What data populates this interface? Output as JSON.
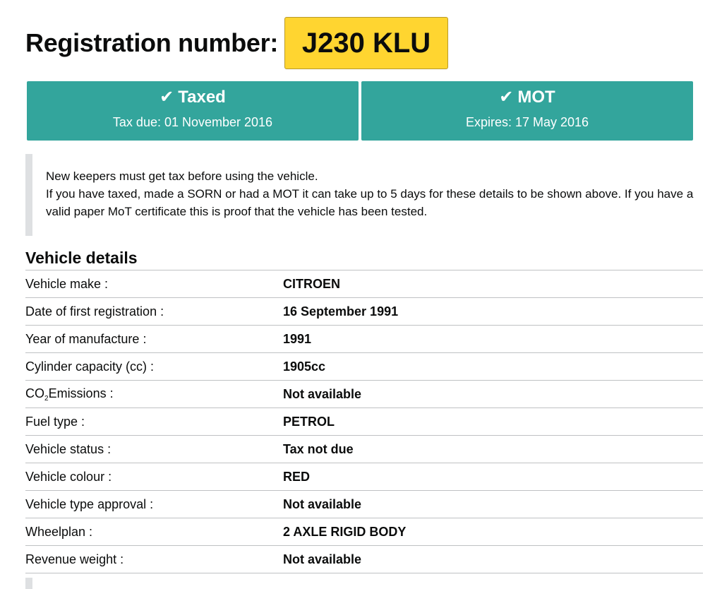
{
  "registration": {
    "label": "Registration number:",
    "plate": "J230 KLU",
    "plate_color": "#ffd530"
  },
  "status": {
    "accent_color": "#33a59c",
    "tax": {
      "icon": "check-icon",
      "title": "Taxed",
      "subtitle": "Tax due: 01 November 2016"
    },
    "mot": {
      "icon": "check-icon",
      "title": "MOT",
      "subtitle": "Expires: 17 May 2016"
    }
  },
  "notice": {
    "line1": "New keepers must get tax before using the vehicle.",
    "line2": "If you have taxed, made a SORN or had a MOT it can take up to 5 days for these details to be shown above. If you have a valid paper MoT certificate this is proof that the vehicle has been tested."
  },
  "vehicle_details": {
    "title": "Vehicle details",
    "co2_label": {
      "prefix": "CO",
      "subscript": "2",
      "suffix": "Emissions :"
    },
    "rows": [
      {
        "key": "Vehicle make :",
        "value": "CITROEN"
      },
      {
        "key": "Date of first registration :",
        "value": "16 September 1991"
      },
      {
        "key": "Year of manufacture :",
        "value": "1991"
      },
      {
        "key": "Cylinder capacity (cc) :",
        "value": "1905cc"
      },
      {
        "key": "",
        "value": "Not available"
      },
      {
        "key": "Fuel type :",
        "value": "PETROL"
      },
      {
        "key": "Vehicle status :",
        "value": "Tax not due"
      },
      {
        "key": "Vehicle colour :",
        "value": "RED"
      },
      {
        "key": "Vehicle type approval :",
        "value": "Not available"
      },
      {
        "key": "Wheelplan :",
        "value": "2 AXLE RIGID BODY"
      },
      {
        "key": "Revenue weight :",
        "value": "Not available"
      }
    ]
  }
}
